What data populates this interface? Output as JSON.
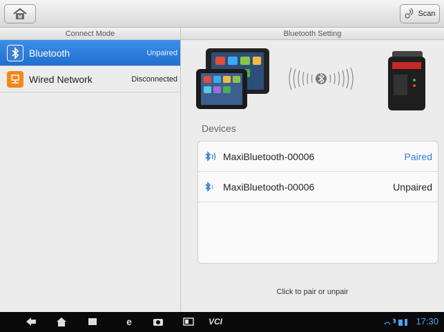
{
  "toolbar": {
    "home_icon": "home-icon",
    "scan_label": "Scan",
    "scan_icon": "radar-icon"
  },
  "columns": {
    "left_title": "Connect Mode",
    "right_title": "Bluetooth Setting"
  },
  "connect_modes": [
    {
      "label": "Bluetooth",
      "status": "Unpaired",
      "icon": "bluetooth-icon",
      "selected": true,
      "icon_color": "#3a7fd5"
    },
    {
      "label": "Wired Network",
      "status": "Disconnected",
      "icon": "network-icon",
      "selected": false,
      "icon_color": "#f2871c"
    }
  ],
  "bluetooth": {
    "devices_title": "Devices",
    "devices": [
      {
        "name": "MaxiBluetooth-00006",
        "status": "Paired"
      },
      {
        "name": "MaxiBluetooth-00006",
        "status": "Unpaired"
      }
    ],
    "hint": "Click to pair or unpair"
  },
  "statusbar": {
    "vci_label": "VCI",
    "time": "17:30"
  },
  "colors": {
    "selected_row": "#1f6fd0",
    "paired_text": "#2f7fd8",
    "clock": "#4aa3ff"
  }
}
